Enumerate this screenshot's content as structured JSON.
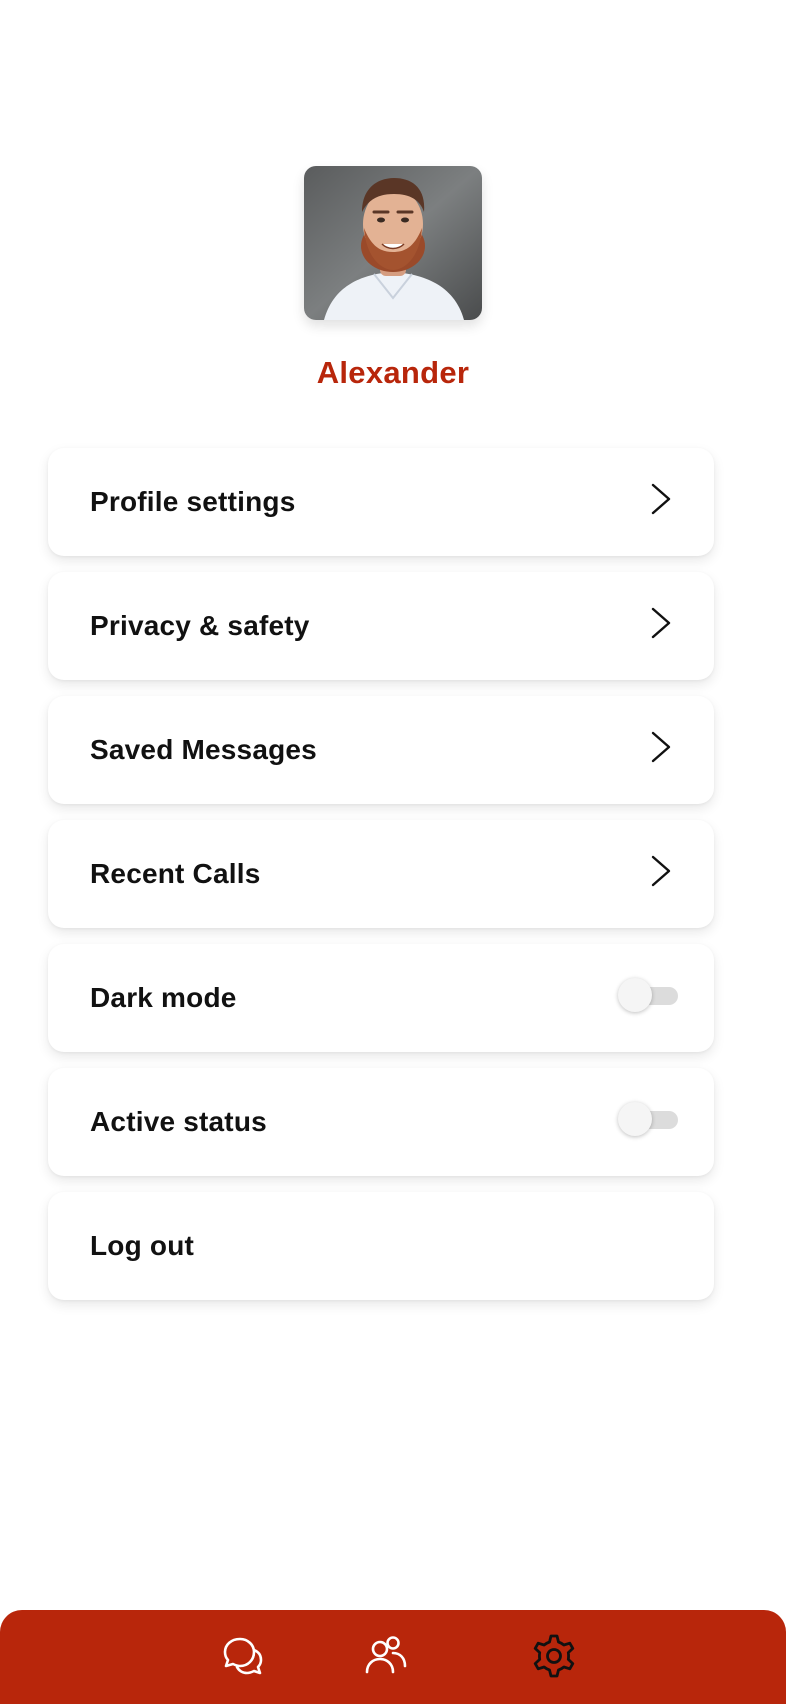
{
  "profile": {
    "name": "Alexander",
    "avatar_icon": "profile-photo"
  },
  "menu": {
    "profile_settings": "Profile settings",
    "privacy_safety": "Privacy & safety",
    "saved_messages": "Saved Messages",
    "recent_calls": "Recent Calls",
    "dark_mode": "Dark mode",
    "active_status": "Active status",
    "log_out": "Log out"
  },
  "toggles": {
    "dark_mode_on": false,
    "active_status_on": false
  },
  "nav": {
    "items": [
      {
        "icon": "chats-icon",
        "active": false
      },
      {
        "icon": "contacts-icon",
        "active": false
      },
      {
        "icon": "gear-icon",
        "active": true
      }
    ]
  },
  "colors": {
    "accent": "#b8260b",
    "text": "#111111",
    "toggle_off_track": "#dcdcdc"
  }
}
